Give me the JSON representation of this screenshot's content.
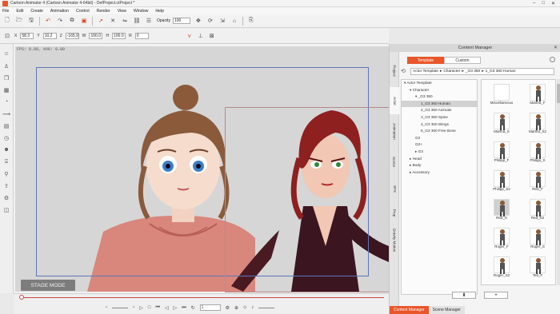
{
  "window": {
    "title": "Cartoon Animator 4 (Cartoon Animator 4-64bit) - DefProject.ctProject *",
    "controls": [
      "–",
      "□",
      "✕"
    ]
  },
  "menu": [
    "File",
    "Edit",
    "Create",
    "Animation",
    "Control",
    "Render",
    "View",
    "Window",
    "Help"
  ],
  "toolbar": {
    "opacity_label": "Opacity",
    "opacity_value": "100"
  },
  "transform": {
    "fields": [
      {
        "label": "X",
        "value": "58.3"
      },
      {
        "label": "Y",
        "value": "10.2"
      },
      {
        "label": "Z",
        "value": "-165.9"
      },
      {
        "label": "W",
        "value": "100.0"
      },
      {
        "label": "H",
        "value": "100.0"
      },
      {
        "label": "R",
        "value": "0"
      }
    ]
  },
  "stage": {
    "fps_text": "FPS: 0.00, AVG: 0.00",
    "stage_mode_label": "STAGE MODE"
  },
  "timeline": {
    "frame_value": "1"
  },
  "content_manager": {
    "title": "Content Manager",
    "close": "✕",
    "side_tabs": [
      "Project",
      "Actor",
      "Animation",
      "Scene",
      "SFX",
      "Prop",
      "Gravity Motion"
    ],
    "active_side_tab": "Actor",
    "segments": [
      "Template",
      "Custom"
    ],
    "breadcrumb": [
      "Actor Template",
      "Character",
      "_G3 360",
      "1_G3 360 Human"
    ],
    "tree": [
      {
        "label": "▾ Actor Template",
        "indent": 0
      },
      {
        "label": "▾ Character",
        "indent": 1
      },
      {
        "label": "▾ _G3 360",
        "indent": 2
      },
      {
        "label": "1_G3 360 Human",
        "indent": 3,
        "selected": true
      },
      {
        "label": "2_G3 360 Animals",
        "indent": 3
      },
      {
        "label": "3_G3 360 Spine",
        "indent": 3
      },
      {
        "label": "4_G3 360 Wings",
        "indent": 3
      },
      {
        "label": "5_G3 360 Free Bone",
        "indent": 3
      },
      {
        "label": "G2",
        "indent": 2
      },
      {
        "label": "G2+",
        "indent": 2
      },
      {
        "label": "▸ G3",
        "indent": 2
      },
      {
        "label": "▸ Head",
        "indent": 1
      },
      {
        "label": "▸ Body",
        "indent": 1
      },
      {
        "label": "▸ Accessory",
        "indent": 1
      }
    ],
    "thumbnails": [
      {
        "label": "Miscellaneous",
        "folder": true
      },
      {
        "label": "Martha_F"
      },
      {
        "label": "Martha_S"
      },
      {
        "label": "Martha_S2"
      },
      {
        "label": "Philipp_F"
      },
      {
        "label": "Philipp_S"
      },
      {
        "label": "Philipp_S2"
      },
      {
        "label": "Red_F"
      },
      {
        "label": "Red_S",
        "selected": true
      },
      {
        "label": "Red_S2"
      },
      {
        "label": "Roger_F"
      },
      {
        "label": "Roger_S"
      },
      {
        "label": "Roger_S2"
      },
      {
        "label": "Ted_F"
      }
    ],
    "buttons": [
      "⬇",
      "+"
    ],
    "bottom_tabs": [
      "Content Manager",
      "Scene Manager"
    ]
  }
}
